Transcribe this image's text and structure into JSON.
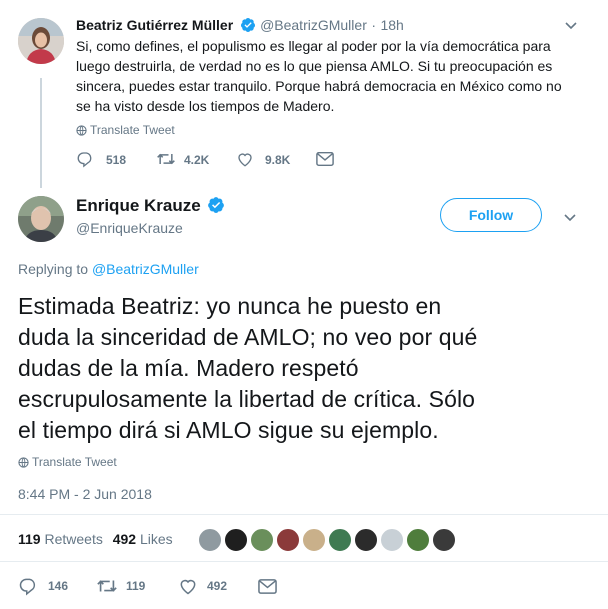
{
  "reply_tweet": {
    "name": "Beatriz Gutiérrez Müller",
    "handle": "@BeatrizGMuller",
    "separator": "·",
    "time": "18h",
    "text_lines": [
      "Si, como defines, el populismo es llegar al poder por la vía democrática para",
      "luego destruirla, de verdad no es lo que piensa AMLO. Si tu preocupación es",
      "sincera, puedes estar tranquilo. Porque habrá democracia en México como no",
      "se ha visto desde los tiempos de Madero."
    ],
    "translate": "Translate Tweet",
    "reply_count": "518",
    "retweet_count": "4.2K",
    "like_count": "9.8K"
  },
  "main_tweet": {
    "name": "Enrique Krauze",
    "handle": "@EnriqueKrauze",
    "follow_label": "Follow",
    "replying_to_label": "Replying to",
    "replying_to_handle": "@BeatrizGMuller",
    "text_lines": [
      "Estimada Beatriz: yo nunca he puesto en",
      "duda la sinceridad de AMLO; no veo por qué",
      "dudas de la mía. Madero respetó",
      "escrupulosamente la libertad de crítica. Sólo",
      "el tiempo dirá si AMLO sigue su ejemplo."
    ],
    "translate": "Translate Tweet",
    "timestamp": "8:44 PM - 2 Jun 2018",
    "retweets_count": "119",
    "retweets_label": "Retweets",
    "likes_count": "492",
    "likes_label": "Likes",
    "reply_count": "146",
    "retweet_count": "119",
    "like_count": "492"
  },
  "colors": {
    "accent": "#1da1f2",
    "muted": "#657786",
    "divider": "#e6ecf0",
    "verified": "#1da1f2"
  }
}
